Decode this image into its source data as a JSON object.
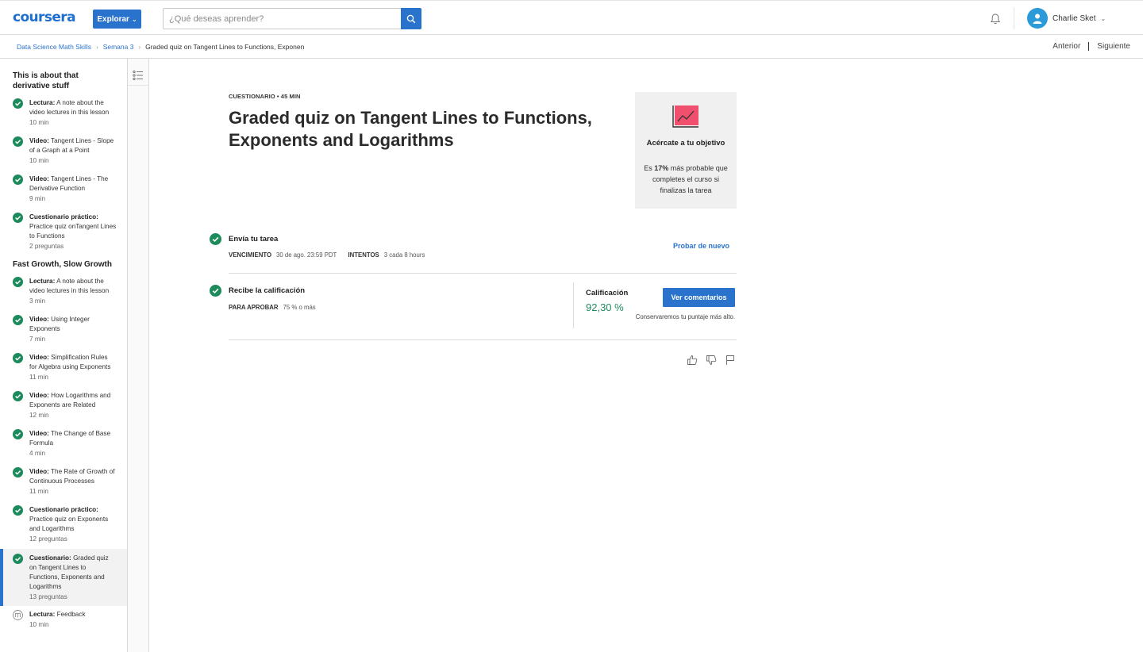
{
  "header": {
    "logo": "coursera",
    "explore_label": "Explorar",
    "search_placeholder": "¿Qué deseas aprender?",
    "user_name": "Charlie Sket"
  },
  "breadcrumb": {
    "items": [
      "Data Science Math Skills",
      "Semana 3"
    ],
    "current": "Graded quiz on Tangent Lines to Functions, Exponent"
  },
  "nav": {
    "prev": "Anterior",
    "next": "Siguiente"
  },
  "sidebar": {
    "sections": [
      {
        "title": "This is about that derivative stuff",
        "items": [
          {
            "type": "Lectura:",
            "name": "A note about the video lectures in this lesson",
            "meta": "10 min"
          },
          {
            "type": "Video:",
            "name": "Tangent Lines - Slope of a Graph at a Point",
            "meta": "10 min"
          },
          {
            "type": "Video:",
            "name": "Tangent Lines - The Derivative Function",
            "meta": "9 min"
          },
          {
            "type": "Cuestionario práctico:",
            "name": "Practice quiz onTangent Lines to Functions",
            "meta": "2 preguntas"
          }
        ]
      },
      {
        "title": "Fast Growth, Slow Growth",
        "items": [
          {
            "type": "Lectura:",
            "name": "A note about the video lectures in this lesson",
            "meta": "3 min"
          },
          {
            "type": "Video:",
            "name": "Using Integer Exponents",
            "meta": "7 min"
          },
          {
            "type": "Video:",
            "name": "Simplification Rules for Algebra using Exponents",
            "meta": "11 min"
          },
          {
            "type": "Video:",
            "name": "How Logarithms and Exponents are Related",
            "meta": "12 min"
          },
          {
            "type": "Video:",
            "name": "The Change of Base Formula",
            "meta": "4 min"
          },
          {
            "type": "Video:",
            "name": "The Rate of Growth of Continuous Processes",
            "meta": "11 min"
          },
          {
            "type": "Cuestionario práctico:",
            "name": "Practice quiz on Exponents and Logarithms",
            "meta": "12 preguntas"
          },
          {
            "type": "Cuestionario:",
            "name": "Graded quiz on Tangent Lines to Functions, Exponents and Logarithms",
            "meta": "13 preguntas"
          },
          {
            "type": "Lectura:",
            "name": "Feedback",
            "meta": "10 min"
          }
        ]
      }
    ]
  },
  "main": {
    "eyebrow": "CUESTIONARIO • 45 MIN",
    "title": "Graded quiz on Tangent Lines to Functions, Exponents and Logarithms",
    "goal": {
      "title": "Acércate a tu objetivo",
      "desc_prefix": "Es ",
      "desc_pct": "17%",
      "desc_suffix": " más probable que completes el curso si finalizas la tarea"
    },
    "submit": {
      "title": "Envía tu tarea",
      "due_label": "VENCIMIENTO",
      "due_value": "30 de ago. 23:59 PDT",
      "attempts_label": "INTENTOS",
      "attempts_value": "3 cada 8 hours",
      "retry": "Probar de nuevo"
    },
    "grade": {
      "title": "Recibe la calificación",
      "pass_label": "PARA APROBAR",
      "pass_value": "75 % o más",
      "grade_label": "Calificación",
      "grade_value": "92,30 %",
      "feedback_btn": "Ver comentarios",
      "note": "Conservaremos tu puntaje más alto."
    }
  },
  "colors": {
    "accent": "#2a73cc",
    "success": "#1d8a5b",
    "goal_icon": "#f0506e"
  }
}
